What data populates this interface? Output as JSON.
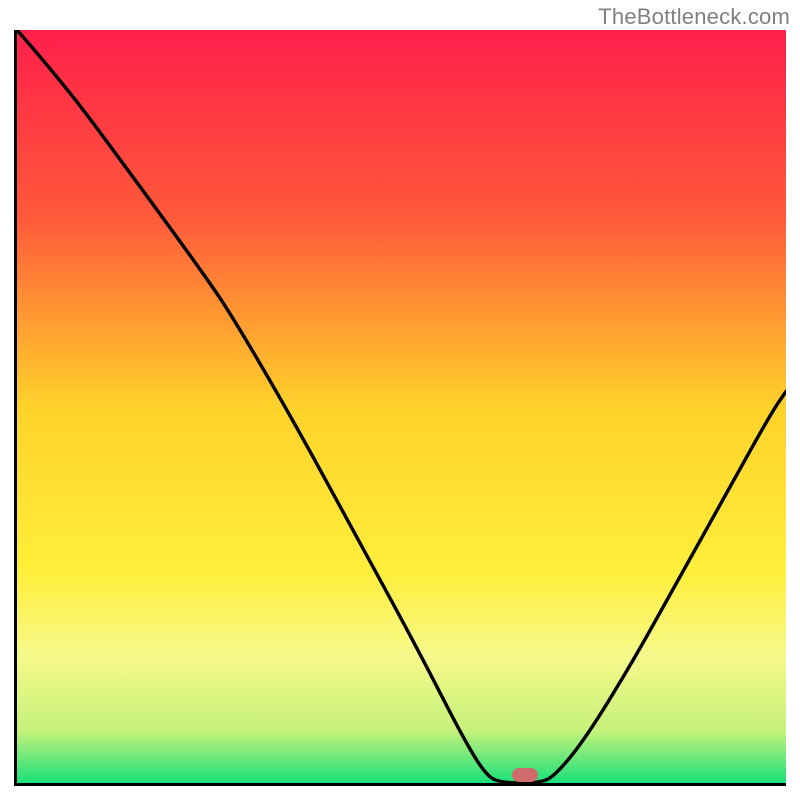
{
  "watermark": "TheBottleneck.com",
  "chart_data": {
    "type": "line",
    "title": "",
    "xlabel": "",
    "ylabel": "",
    "xlim": [
      0,
      100
    ],
    "ylim": [
      0,
      100
    ],
    "gradient_stops": [
      {
        "offset": 0,
        "color": "#ff1f4a"
      },
      {
        "offset": 25,
        "color": "#ff5a3a"
      },
      {
        "offset": 50,
        "color": "#ffd22a"
      },
      {
        "offset": 72,
        "color": "#ffef3a"
      },
      {
        "offset": 83,
        "color": "#f6f98a"
      },
      {
        "offset": 93,
        "color": "#c6f27a"
      },
      {
        "offset": 100,
        "color": "#18e07a"
      }
    ],
    "series": [
      {
        "name": "bottleneck-curve",
        "color": "#000000",
        "points": [
          {
            "x": 0,
            "y": 100
          },
          {
            "x": 6,
            "y": 93
          },
          {
            "x": 14,
            "y": 82
          },
          {
            "x": 24,
            "y": 68
          },
          {
            "x": 28,
            "y": 62
          },
          {
            "x": 36,
            "y": 48
          },
          {
            "x": 44,
            "y": 33
          },
          {
            "x": 52,
            "y": 18
          },
          {
            "x": 58,
            "y": 6
          },
          {
            "x": 61,
            "y": 1
          },
          {
            "x": 63,
            "y": 0
          },
          {
            "x": 68,
            "y": 0
          },
          {
            "x": 70,
            "y": 1
          },
          {
            "x": 74,
            "y": 6
          },
          {
            "x": 80,
            "y": 16
          },
          {
            "x": 86,
            "y": 27
          },
          {
            "x": 92,
            "y": 38
          },
          {
            "x": 98,
            "y": 49
          },
          {
            "x": 100,
            "y": 52
          }
        ]
      }
    ],
    "marker": {
      "x": 66,
      "y": 1,
      "color": "#cf6a6d"
    }
  }
}
